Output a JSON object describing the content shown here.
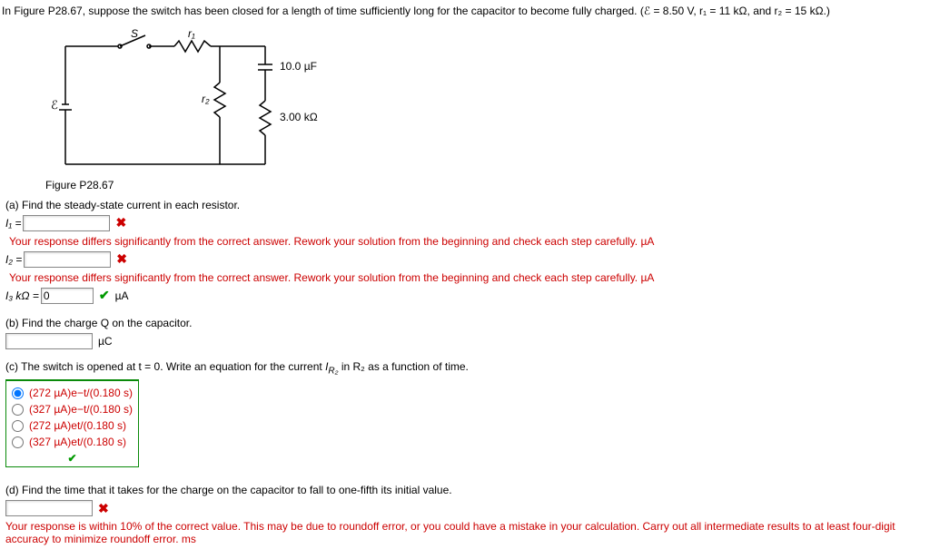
{
  "problem": {
    "intro": "In Figure P28.67, suppose the switch has been closed for a length of time sufficiently long for the capacitor to become fully charged. (ℰ = 8.50 V, r₁ = 11 kΩ, and r₂ = 15 kΩ.)"
  },
  "figure": {
    "caption": "Figure P28.67",
    "labels": {
      "s": "S",
      "r1": "r₁",
      "r2": "r₂",
      "emf": "ℰ",
      "cap": "10.0 µF",
      "r_extra": "3.00 kΩ"
    }
  },
  "partA": {
    "title": "(a) Find the steady-state current in each resistor.",
    "i1_label": "I₁ = ",
    "i2_label": "I₂ = ",
    "i3_label": "I₃ kΩ = ",
    "i3_value": "0",
    "unit": "µA",
    "feedback_long": "Your response differs significantly from the correct answer. Rework your solution from the beginning and check each step carefully. µA"
  },
  "partB": {
    "title": "(b) Find the charge Q on the capacitor.",
    "unit": "µC"
  },
  "partC": {
    "title_pre": "(c) The switch is opened at t = 0. Write an equation for the current ",
    "title_mid": "I",
    "title_sub": "R₂",
    "title_post": " in R₂ as a function of time.",
    "options": [
      {
        "text": "(272 µA)e−t/(0.180 s)",
        "selected": true
      },
      {
        "text": "(327 µA)e−t/(0.180 s)",
        "selected": false
      },
      {
        "text": "(272 µA)et/(0.180 s)",
        "selected": false
      },
      {
        "text": "(327 µA)et/(0.180 s)",
        "selected": false
      }
    ]
  },
  "partD": {
    "title": "(d) Find the time that it takes for the charge on the capacitor to fall to one-fifth its initial value.",
    "feedback": "Your response is within 10% of the correct value. This may be due to roundoff error, or you could have a mistake in your calculation. Carry out all intermediate results to at least four-digit accuracy to minimize roundoff error. ms"
  },
  "icons": {
    "x": "✖",
    "check": "✔"
  }
}
